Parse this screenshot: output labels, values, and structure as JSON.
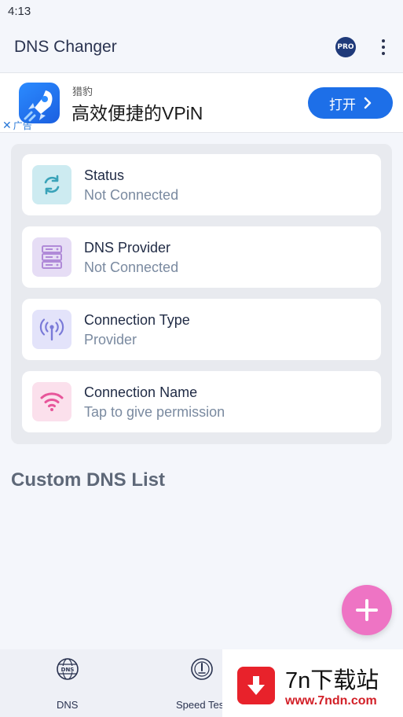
{
  "status_bar": {
    "time": "4:13"
  },
  "app_bar": {
    "title": "DNS Changer",
    "pro_badge": "PRO",
    "more_icon": "more-vert-icon"
  },
  "ad": {
    "brand": "猎豹",
    "headline": "高效便捷的VPiN",
    "cta": "打开",
    "label": "广告",
    "close_symbol": "✕",
    "icon": "rocket-icon"
  },
  "info_cards": [
    {
      "title": "Status",
      "value": "Not Connected",
      "icon": "sync-icon",
      "icon_bg": "#cdebf1",
      "icon_color": "#3aa3b9"
    },
    {
      "title": "DNS Provider",
      "value": "Not Connected",
      "icon": "server-icon",
      "icon_bg": "#e6ddf5",
      "icon_color": "#b08ad8"
    },
    {
      "title": "Connection Type",
      "value": "Provider",
      "icon": "antenna-icon",
      "icon_bg": "#e3e3fa",
      "icon_color": "#7a7ad8"
    },
    {
      "title": "Connection Name",
      "value": "Tap to give permission",
      "icon": "wifi-icon",
      "icon_bg": "#fbe0ec",
      "icon_color": "#e7559a"
    }
  ],
  "custom_list": {
    "title": "Custom DNS List"
  },
  "fab": {
    "icon": "plus-icon",
    "color": "#ee74c4"
  },
  "bottom_nav": [
    {
      "label": "DNS",
      "icon": "dns-globe-icon"
    },
    {
      "label": "Speed Tes",
      "icon": "speed-test-icon"
    }
  ],
  "watermark": {
    "title": "7n下载站",
    "url": "www.7ndn.com"
  }
}
